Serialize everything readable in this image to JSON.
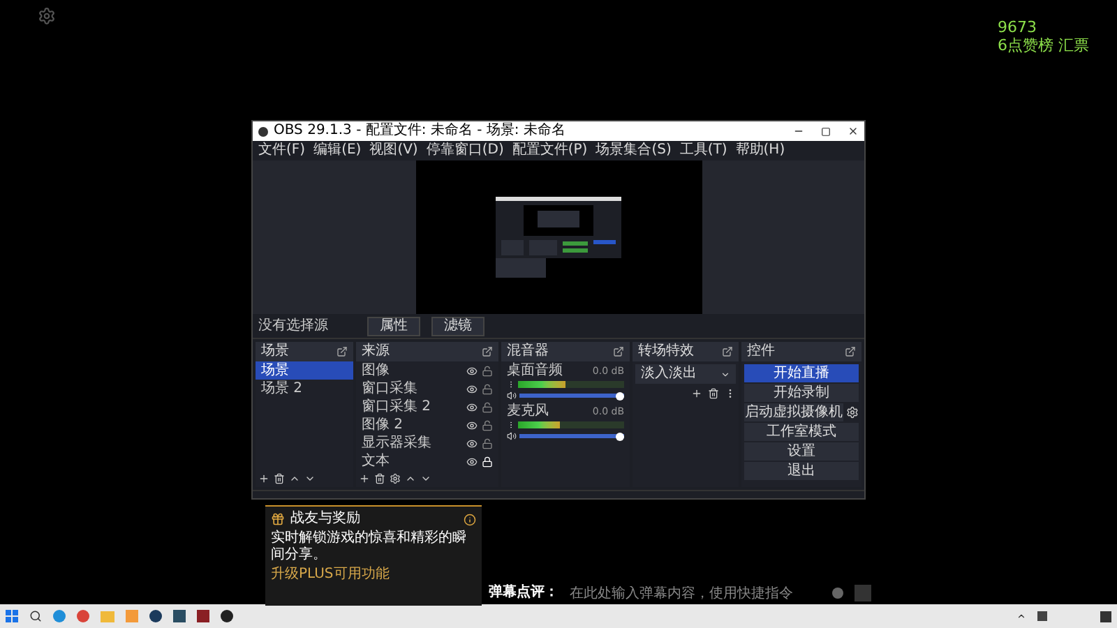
{
  "overlay": {
    "counter": "9673",
    "caption": "6点赞榜 汇票"
  },
  "obs": {
    "title": "OBS 29.1.3 - 配置文件: 未命名 - 场景: 未命名",
    "menu": [
      "文件(F)",
      "编辑(E)",
      "视图(V)",
      "停靠窗口(D)",
      "配置文件(P)",
      "场景集合(S)",
      "工具(T)",
      "帮助(H)"
    ],
    "source_toolbar": {
      "label": "没有选择源",
      "buttons": [
        "属性",
        "滤镜"
      ]
    },
    "scenes": {
      "title": "场景",
      "items": [
        {
          "label": "场景",
          "selected": true
        },
        {
          "label": "场景 2",
          "selected": false
        }
      ]
    },
    "sources": {
      "title": "来源",
      "items": [
        {
          "label": "图像",
          "locked": false
        },
        {
          "label": "窗口采集",
          "locked": false
        },
        {
          "label": "窗口采集 2",
          "locked": false
        },
        {
          "label": "图像 2",
          "locked": false
        },
        {
          "label": "显示器采集",
          "locked": false
        },
        {
          "label": "文本",
          "locked": true
        }
      ]
    },
    "mixer": {
      "title": "混音器",
      "channels": [
        {
          "name": "桌面音频",
          "reading": "0.0 dB",
          "meter": {
            "level": 0.45
          },
          "volume": {
            "level": 1
          }
        },
        {
          "name": "麦克风",
          "reading": "0.0 dB",
          "meter": {
            "level": 0.4
          },
          "volume": {
            "level": 1
          }
        }
      ]
    },
    "transitions": {
      "title": "转场特效",
      "value": "淡入淡出"
    },
    "controls": {
      "title": "控件",
      "buttons": [
        {
          "label": "开始直播",
          "kind": "primary"
        },
        {
          "label": "开始录制",
          "kind": "normal"
        },
        {
          "label": "启动虚拟摄像机",
          "kind": "settings"
        },
        {
          "label": "工作室模式",
          "kind": "normal"
        },
        {
          "label": "设置",
          "kind": "normal"
        },
        {
          "label": "退出",
          "kind": "normal"
        }
      ]
    }
  },
  "notification": {
    "title": "战友与奖励",
    "body": "实时解锁游戏的惊喜和精彩的瞬间分享。",
    "link": "升级PLUS可用功能"
  },
  "comment_bar": {
    "label": "弹幕点评：",
    "placeholder": "在此处输入弹幕内容，使用快捷指令"
  }
}
